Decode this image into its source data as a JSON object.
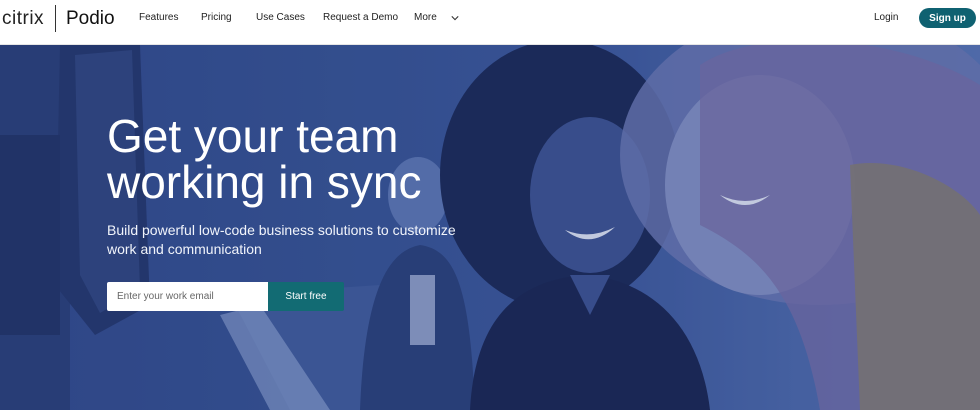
{
  "header": {
    "brand_citrix": "citrix",
    "brand_podio": "Podio",
    "nav": [
      "Features",
      "Pricing",
      "Use Cases",
      "Request a Demo",
      "More"
    ],
    "login": "Login",
    "signup": "Sign up"
  },
  "hero": {
    "headline": "Get your team working in sync",
    "subhead": "Build powerful low-code business solutions to customize work and communication",
    "email_placeholder": "Enter your work email",
    "cta": "Start free"
  },
  "colors": {
    "accent": "#0f6171",
    "hero_overlay": "#34508f"
  }
}
